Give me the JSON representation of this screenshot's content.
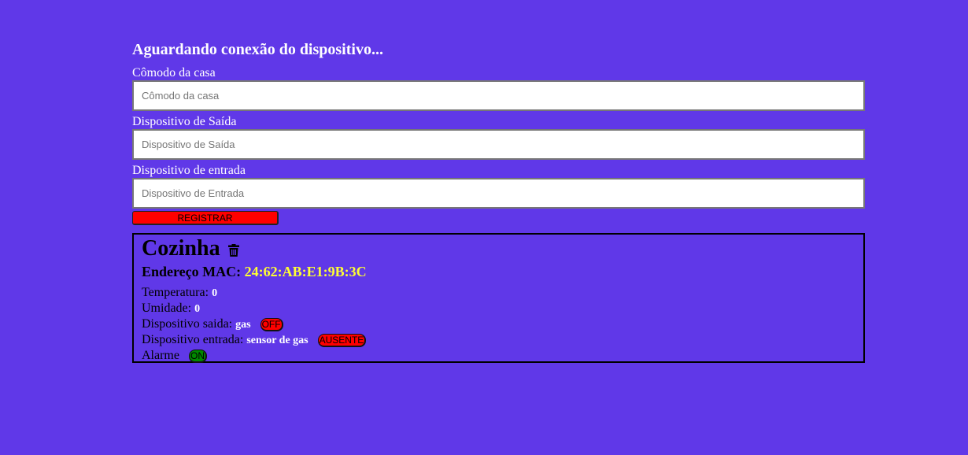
{
  "status": "Aguardando conexão do dispositivo...",
  "form": {
    "room_label": "Cômodo da casa",
    "room_placeholder": "Cômodo da casa",
    "room_value": "",
    "output_label": "Dispositivo de Saída",
    "output_placeholder": "Dispositivo de Saída",
    "output_value": "",
    "input_label": "Dispositivo de entrada",
    "input_placeholder": "Dispositivo de Entrada",
    "input_value": "",
    "register_label": "REGISTRAR"
  },
  "card": {
    "room": "Cozinha",
    "delete_icon": "trash-icon",
    "mac_label": "Endereço MAC:",
    "mac_value": "24:62:AB:E1:9B:3C",
    "temperature_label": "Temperatura:",
    "temperature_value": "0",
    "humidity_label": "Umidade:",
    "humidity_value": "0",
    "output_label": "Dispositivo saida:",
    "output_value": "gas",
    "output_state": "OFF",
    "input_label": "Dispositivo entrada:",
    "input_value": "sensor de gas",
    "input_state": "AUSENTE",
    "alarm_label": "Alarme",
    "alarm_state": "ON"
  },
  "colors": {
    "background": "#6038e8",
    "mac_value": "#ffff33",
    "red_state": "#ff0000",
    "green_state": "#008800"
  }
}
